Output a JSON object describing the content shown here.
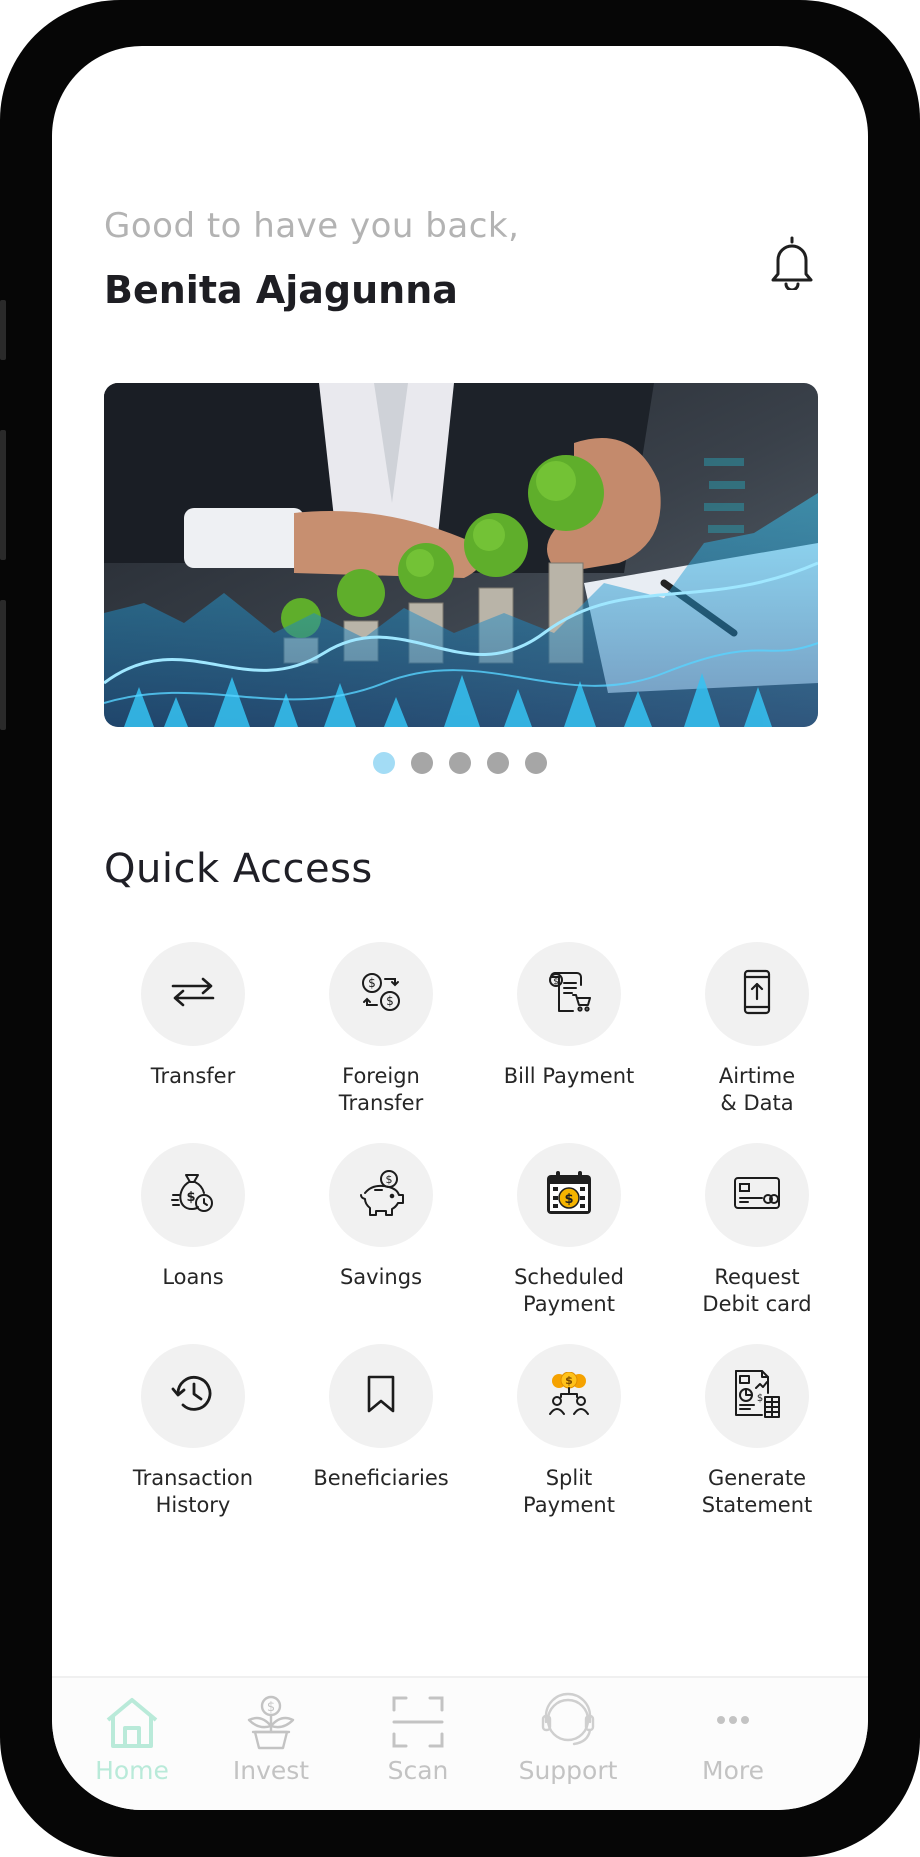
{
  "header": {
    "greeting": "Good to have you back,",
    "user_name": "Benita Ajagunna",
    "notification_icon": "bell-icon"
  },
  "carousel": {
    "slide_count": 5,
    "active_index": 0,
    "active_color": "#a3dcf5",
    "inactive_color": "#a6a6a6"
  },
  "quick_access": {
    "title": "Quick Access",
    "items": [
      {
        "label": "Transfer",
        "icon": "transfer-arrows-icon"
      },
      {
        "label": "Foreign\nTransfer",
        "icon": "currency-exchange-icon"
      },
      {
        "label": "Bill Payment",
        "icon": "bill-receipt-icon"
      },
      {
        "label": "Airtime\n& Data",
        "icon": "mobile-topup-icon"
      },
      {
        "label": "Loans",
        "icon": "money-bag-icon"
      },
      {
        "label": "Savings",
        "icon": "piggy-bank-icon"
      },
      {
        "label": "Scheduled\nPayment",
        "icon": "calendar-dollar-icon"
      },
      {
        "label": "Request\nDebit card",
        "icon": "debit-card-icon"
      },
      {
        "label": "Transaction\nHistory",
        "icon": "history-clock-icon"
      },
      {
        "label": "Beneficiaries",
        "icon": "bookmark-icon"
      },
      {
        "label": "Split\nPayment",
        "icon": "split-people-icon"
      },
      {
        "label": "Generate\nStatement",
        "icon": "statement-report-icon"
      }
    ]
  },
  "tabbar": {
    "active_color": "#b9ead9",
    "items": [
      {
        "label": "Home",
        "icon": "home-icon",
        "active": true
      },
      {
        "label": "Invest",
        "icon": "plant-money-icon",
        "active": false
      },
      {
        "label": "Scan",
        "icon": "scan-frame-icon",
        "active": false
      },
      {
        "label": "Support",
        "icon": "headset-icon",
        "active": false
      },
      {
        "label": "More",
        "icon": "more-dots-icon",
        "active": false
      }
    ]
  }
}
